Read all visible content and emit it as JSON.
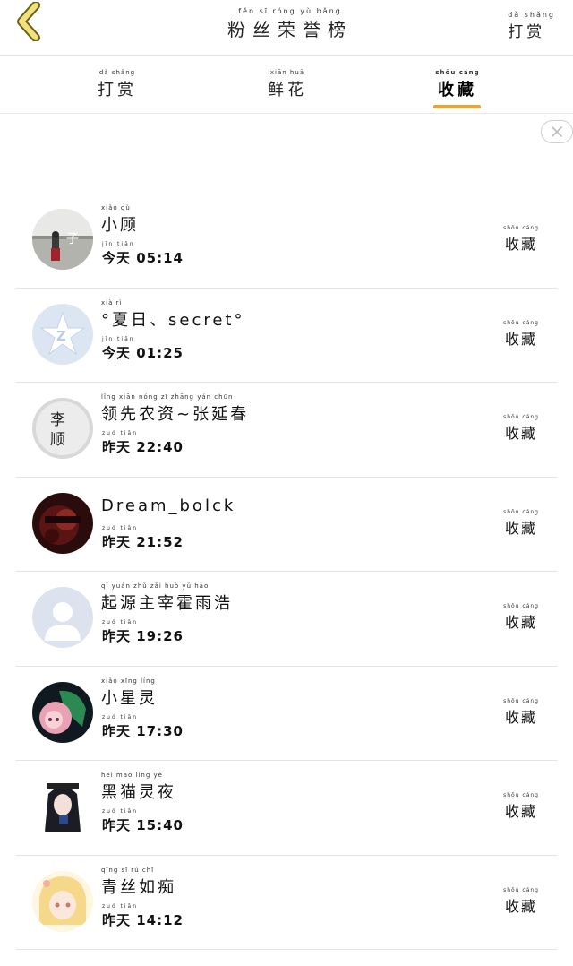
{
  "header": {
    "title_pinyin": "fěn sī róng yù bǎng",
    "title": "粉丝荣誉榜",
    "action_pinyin": "dǎ shǎng",
    "action": "打赏"
  },
  "tabs": [
    {
      "pinyin": "dǎ shǎng",
      "label": "打赏",
      "active": false
    },
    {
      "pinyin": "xiān huā",
      "label": "鲜花",
      "active": false
    },
    {
      "pinyin": "shōu cáng",
      "label": "收藏",
      "active": true
    }
  ],
  "colors": {
    "accent": "#f2a22c",
    "back_icon": "#f1e27a"
  },
  "list": {
    "items": [
      {
        "name_pinyin": "xiǎo gù",
        "name": "小顾",
        "time_pinyin": "jīn tiān",
        "time": "今天 05:14",
        "action_pinyin": "shōu cáng",
        "action": "收藏",
        "avatar": "photo-lake"
      },
      {
        "name_pinyin": "xià rì",
        "name": "°夏日、secret°",
        "time_pinyin": "jīn tiān",
        "time": "今天 01:25",
        "action_pinyin": "shōu cáng",
        "action": "收藏",
        "avatar": "qzone-star"
      },
      {
        "name_pinyin": "lǐng xiān nóng zī zhāng yán chūn",
        "name": "领先农资~张延春",
        "time_pinyin": "zuó tiān",
        "time": "昨天 22:40",
        "action_pinyin": "shōu cáng",
        "action": "收藏",
        "avatar": "calligraphy"
      },
      {
        "name_pinyin": "",
        "name": "Dream_bolck",
        "time_pinyin": "zuó tiān",
        "time": "昨天 21:52",
        "action_pinyin": "shōu cáng",
        "action": "收藏",
        "avatar": "dark-red"
      },
      {
        "name_pinyin": "qǐ yuán zhǔ zǎi huò yǔ hào",
        "name": "起源主宰霍雨浩",
        "time_pinyin": "zuó tiān",
        "time": "昨天 19:26",
        "action_pinyin": "shōu cáng",
        "action": "收藏",
        "avatar": "default-person"
      },
      {
        "name_pinyin": "xiǎo xīng líng",
        "name": "小星灵",
        "time_pinyin": "zuó tiān",
        "time": "昨天 17:30",
        "action_pinyin": "shōu cáng",
        "action": "收藏",
        "avatar": "anime-pink"
      },
      {
        "name_pinyin": "hēi māo líng yè",
        "name": "黑猫灵夜",
        "time_pinyin": "zuó tiān",
        "time": "昨天 15:40",
        "action_pinyin": "shōu cáng",
        "action": "收藏",
        "avatar": "anime-dark"
      },
      {
        "name_pinyin": "qīng sī rú chī",
        "name": "青丝如痴",
        "time_pinyin": "zuó tiān",
        "time": "昨天 14:12",
        "action_pinyin": "shōu cáng",
        "action": "收藏",
        "avatar": "anime-blonde"
      }
    ]
  }
}
